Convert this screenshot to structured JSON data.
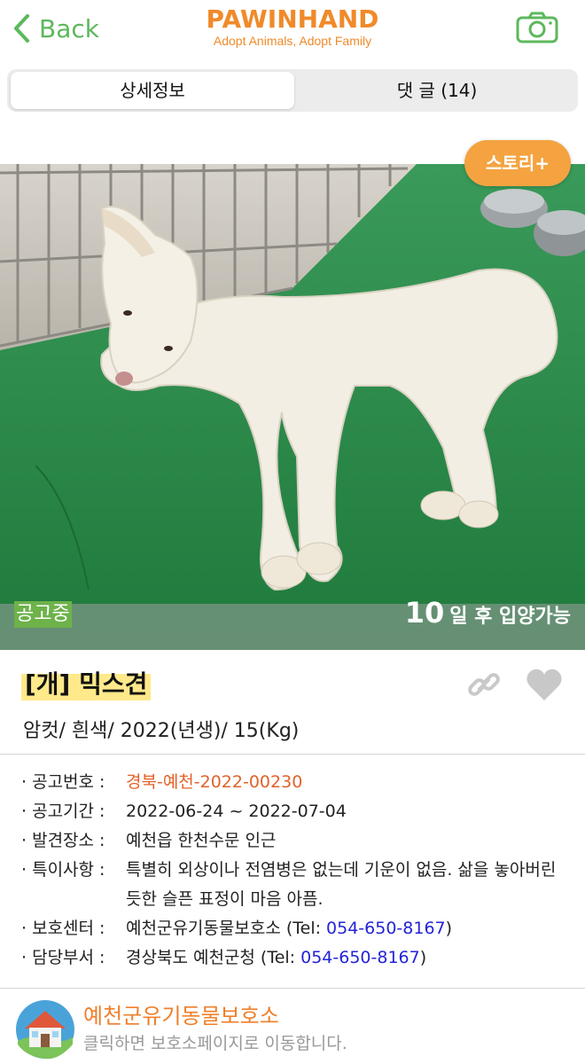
{
  "header": {
    "back_label": "Back",
    "logo_main": "PAWINHAND",
    "logo_sub": "Adopt Animals, Adopt Family"
  },
  "tabs": [
    {
      "label": "상세정보",
      "active": true
    },
    {
      "label": "댓 글 (14)",
      "active": false
    }
  ],
  "story_button": "스토리+",
  "status": {
    "label": "공고중",
    "days": "10",
    "adopt_text": "일 후 입양가능"
  },
  "animal": {
    "title": "[개] 믹스견",
    "summary": "암컷/ 흰색/ 2022(년생)/ 15(Kg)"
  },
  "details": {
    "notice_no_key": "공고번호 :",
    "notice_no": "경북-예천-2022-00230",
    "period_key": "공고기간 :",
    "period": "2022-06-24 ~ 2022-07-04",
    "found_key": "발견장소 :",
    "found": "예천읍 한천수문 인근",
    "note_key": "특이사항 :",
    "note": "특별히 외상이나 전염병은 없는데 기운이 없음. 삶을 놓아버린 듯한 슬픈 표정이 마음 아픔.",
    "center_key": "보호센터 :",
    "center_name": "예천군유기동물보호소 (Tel: ",
    "center_tel": "054-650-8167",
    "center_close": ")",
    "dept_key": "담당부서 :",
    "dept_name": "경상북도 예천군청 (Tel: ",
    "dept_tel": "054-650-8167",
    "dept_close": ")"
  },
  "footer": {
    "shelter_name": "예천군유기동물보호소",
    "shelter_desc": "클릭하면 보호소페이지로 이동합니다."
  },
  "colors": {
    "brand_orange": "#f08a2a",
    "back_green": "#5cb85c",
    "status_green": "#6eb24a",
    "link_blue": "#2424d8"
  }
}
